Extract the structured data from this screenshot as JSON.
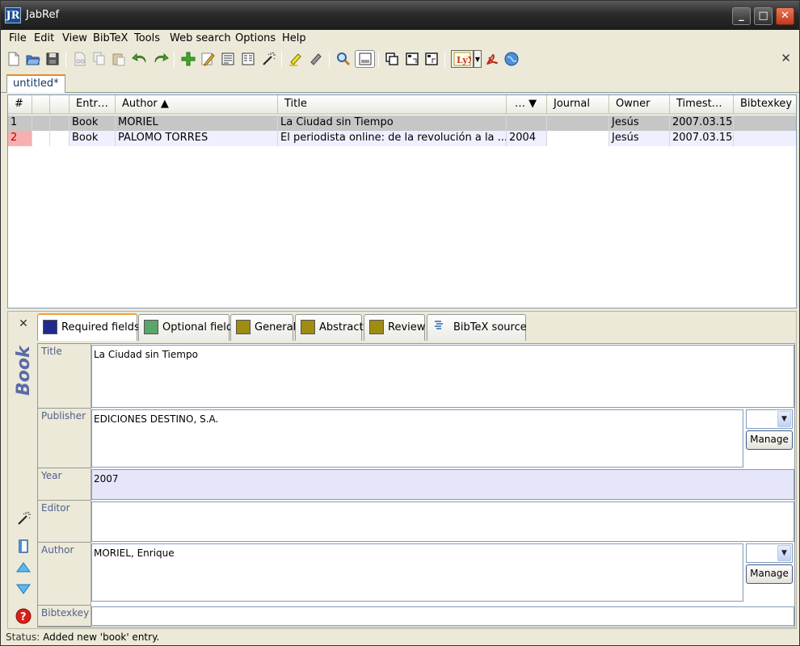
{
  "window": {
    "title": "JabRef",
    "icon_text": "JR",
    "minimize": "_",
    "maximize": "□",
    "close": "✕"
  },
  "menu": [
    "File",
    "Edit",
    "View",
    "BibTeX",
    "Tools",
    "Web search",
    "Options",
    "Help"
  ],
  "toolbar": {
    "icons": [
      "new-icon",
      "open-icon",
      "save-icon",
      "cut-icon",
      "copy-icon",
      "paste-icon",
      "undo-icon",
      "redo-icon",
      "add-entry-icon",
      "edit-entry-icon",
      "preview-icon",
      "preview-alt-icon",
      "cleanup-wand-icon",
      "mark-icon",
      "unmark-icon",
      "search-icon",
      "toggle-groups-icon",
      "duplicate-icon",
      "pull-icon",
      "push-icon",
      "lyx-icon",
      "dropdown-icon",
      "pdf-icon",
      "web-icon"
    ],
    "close": "✕"
  },
  "doc_tab": "untitled*",
  "table": {
    "headers": [
      "#",
      "",
      "",
      "Entr…",
      "Author ▲",
      "Title",
      "… ▼",
      "Journal",
      "Owner",
      "Timest…",
      "Bibtexkey"
    ],
    "rows": [
      [
        "1",
        "",
        "",
        "Book",
        "MORIEL",
        "La Ciudad sin Tiempo",
        "",
        "",
        "Jesús",
        "2007.03.15",
        ""
      ],
      [
        "2",
        "",
        "",
        "Book",
        "PALOMO TORRES",
        "El periodista online: de la revolución a la ...",
        "2004",
        "",
        "Jesús",
        "2007.03.15",
        ""
      ]
    ]
  },
  "editor": {
    "entry_type": "Book",
    "close": "✕",
    "tabs": [
      {
        "label": "Required fields",
        "color": "#1f2a8a"
      },
      {
        "label": "Optional fields",
        "color": "#5aa56a"
      },
      {
        "label": "General",
        "color": "#a08c10"
      },
      {
        "label": "Abstract",
        "color": "#a08c10"
      },
      {
        "label": "Review",
        "color": "#a08c10"
      },
      {
        "label": "BibTeX source",
        "color": ""
      }
    ],
    "fields": [
      {
        "label": "Title",
        "value": "La Ciudad sin Tiempo"
      },
      {
        "label": "Publisher",
        "value": "EDICIONES DESTINO, S.A."
      },
      {
        "label": "Year",
        "value": "2007"
      },
      {
        "label": "Editor",
        "value": ""
      },
      {
        "label": "Author",
        "value": "MORIEL, Enrique"
      },
      {
        "label": "Bibtexkey",
        "value": ""
      }
    ],
    "manage_label": "Manage"
  },
  "status": {
    "prefix": "Status:",
    "message": "Added new 'book' entry."
  }
}
